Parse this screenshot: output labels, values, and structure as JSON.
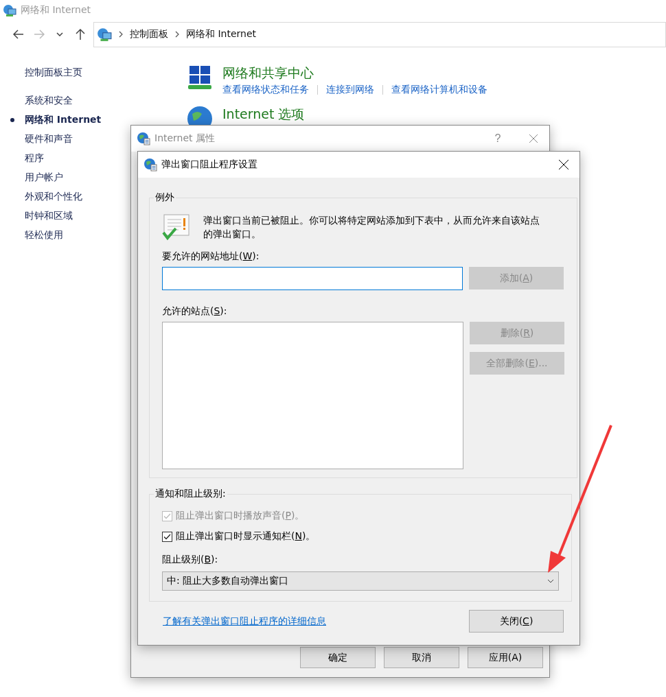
{
  "window": {
    "title": "网络和 Internet"
  },
  "nav_buttons": [
    {
      "kind": "back",
      "disabled": false
    },
    {
      "kind": "forward",
      "disabled": true
    },
    {
      "kind": "recent",
      "disabled": false
    },
    {
      "kind": "up",
      "disabled": false
    }
  ],
  "breadcrumb": [
    "控制面板",
    "网络和 Internet"
  ],
  "sidebar": {
    "home": "控制面板主页",
    "items": [
      {
        "label": "系统和安全",
        "selected": false
      },
      {
        "label": "网络和 Internet",
        "selected": true
      },
      {
        "label": "硬件和声音",
        "selected": false
      },
      {
        "label": "程序",
        "selected": false
      },
      {
        "label": "用户帐户",
        "selected": false
      },
      {
        "label": "外观和个性化",
        "selected": false
      },
      {
        "label": "时钟和区域",
        "selected": false
      },
      {
        "label": "轻松使用",
        "selected": false
      }
    ]
  },
  "categories": [
    {
      "kind": "network",
      "title": "网络和共享中心",
      "links": [
        "查看网络状态和任务",
        "连接到网络",
        "查看网络计算机和设备"
      ]
    },
    {
      "kind": "globe",
      "title": "Internet 选项"
    }
  ],
  "properties_dialog": {
    "title": "Internet 属性",
    "help": "?",
    "buttons": [
      "确定",
      "取消",
      "应用(A)"
    ]
  },
  "popup_dialog": {
    "title": "弹出窗口阻止程序设置",
    "exceptions": {
      "legend": "例外",
      "message": "弹出窗口当前已被阻止。你可以将特定网站添加到下表中，从而允许来自该站点的弹出窗口。",
      "address_label": {
        "text": "要允许的网站地址(",
        "key": "W",
        "rest": "):"
      },
      "add_button": {
        "text": "添加(",
        "key": "A",
        "rest": ")",
        "disabled": true
      },
      "sites_label": {
        "text": "允许的站点(",
        "key": "S",
        "rest": "):"
      },
      "remove_button": {
        "text": "删除(",
        "key": "R",
        "rest": ")",
        "disabled": true
      },
      "remove_all_button": {
        "text": "全部删除(",
        "key": "E",
        "rest": ")...",
        "disabled": true
      }
    },
    "notification": {
      "legend": "通知和阻止级别:",
      "options": [
        {
          "text": "阻止弹出窗口时播放声音(",
          "key": "P",
          "rest": ")。",
          "checked": true,
          "disabled": true
        },
        {
          "text": "阻止弹出窗口时显示通知栏(",
          "key": "N",
          "rest": ")。",
          "checked": true,
          "disabled": false
        }
      ],
      "level_label": {
        "text": "阻止级别(",
        "key": "B",
        "rest": "):"
      },
      "level_value": "中: 阻止大多数自动弹出窗口"
    },
    "help_link": "了解有关弹出窗口阻止程序的详细信息",
    "close_button": {
      "text": "关闭(",
      "key": "C",
      "rest": ")"
    }
  }
}
